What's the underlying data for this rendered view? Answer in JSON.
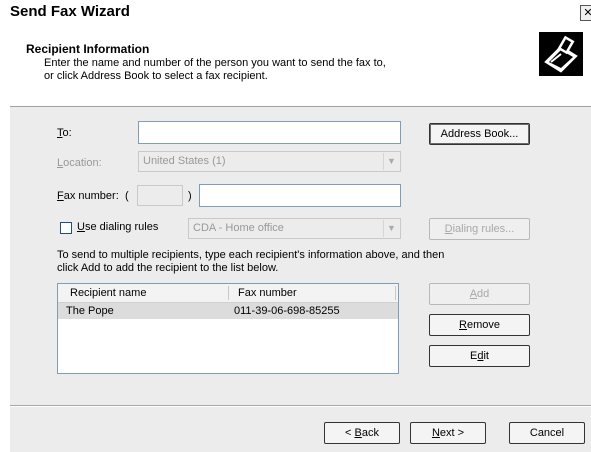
{
  "window": {
    "title": "Send Fax Wizard",
    "close_glyph": "✕"
  },
  "header": {
    "title": "Recipient Information",
    "desc_line1": "Enter the name and number of the person you want to send the fax to,",
    "desc_line2": "or click Address Book to select a fax recipient.",
    "icon": "fax-printer-icon"
  },
  "form": {
    "to_label_mn": "T",
    "to_label_rest": "o:",
    "to_value": "",
    "address_book_label": "Address Book...",
    "location_label_mn": "L",
    "location_label_rest": "ocation:",
    "location_value": "United States (1)",
    "fax_number_label_mn": "F",
    "fax_number_label_rest": "ax number:",
    "fax_open_paren": "(",
    "fax_close_paren": ")",
    "fax_area_code": "",
    "fax_number_value": "",
    "use_dialing_rules_mn": "U",
    "use_dialing_rules_rest": "se dialing rules",
    "use_dialing_rules_checked": false,
    "dialing_location_value": "CDA - Home office",
    "dialing_rules_button_mn": "D",
    "dialing_rules_button_rest": "ialing rules..."
  },
  "multi_hint_line1": "To send to multiple recipients, type each recipient's information above, and then",
  "multi_hint_line2": "click Add to add the recipient to the list below.",
  "recipients": {
    "columns": [
      "Recipient name",
      "Fax number"
    ],
    "rows": [
      {
        "name": "The Pope",
        "fax": "011-39-06-698-85255"
      }
    ]
  },
  "list_buttons": {
    "add_mn": "A",
    "add_rest": "dd",
    "remove_mn": "R",
    "remove_rest": "emove",
    "edit_pre": "E",
    "edit_mn": "d",
    "edit_rest": "it"
  },
  "nav": {
    "back_pre": "< ",
    "back_mn": "B",
    "back_rest": "ack",
    "next_mn": "N",
    "next_rest": "ext >",
    "cancel_label": "Cancel"
  },
  "colors": {
    "body_bg": "#ececec",
    "selected_row": "#dcdcdc",
    "input_border": "#7f9db9"
  }
}
